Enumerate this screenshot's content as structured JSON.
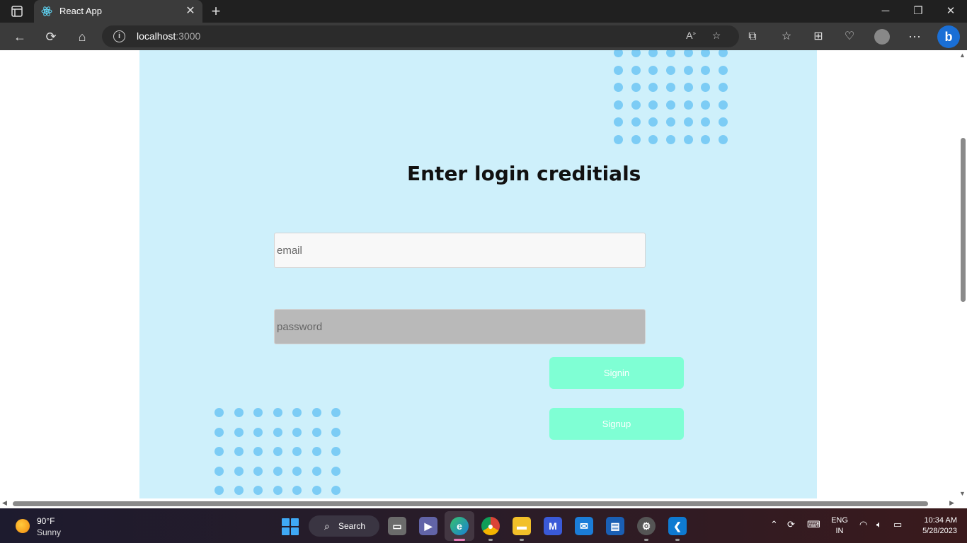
{
  "browser": {
    "tab_title": "React App",
    "tab_close": "✕",
    "new_tab": "+",
    "url_host": "localhost",
    "url_port": ":3000",
    "window_controls": {
      "minimize": "─",
      "restore": "❐",
      "close": "✕"
    },
    "toolbar_icons": [
      "back-icon",
      "refresh-icon",
      "home-icon",
      "read-aloud-icon",
      "add-favorite-icon",
      "extensions-icon",
      "favorites-icon",
      "collections-icon",
      "health-icon",
      "profile-icon",
      "more-icon",
      "bing-icon"
    ]
  },
  "page": {
    "heading": "Enter login creditials",
    "email_placeholder": "email",
    "password_placeholder": "password",
    "signin_label": "Signin",
    "signup_label": "Signup",
    "colors": {
      "panel_bg": "#cef0fb",
      "dot": "#7cccf5",
      "button": "#7fffd4",
      "password_bg": "#b9b9b9"
    }
  },
  "taskbar": {
    "temperature": "90°F",
    "condition": "Sunny",
    "search_label": "Search",
    "language": "ENG",
    "region": "IN",
    "time": "10:34 AM",
    "date": "5/28/2023",
    "pinned_apps": [
      "start-icon",
      "task-view-icon",
      "teams-meet-icon",
      "edge-icon",
      "chrome-icon",
      "file-explorer-icon",
      "visual-studio-icon",
      "mail-icon",
      "store-icon",
      "settings-icon",
      "vscode-icon"
    ]
  }
}
